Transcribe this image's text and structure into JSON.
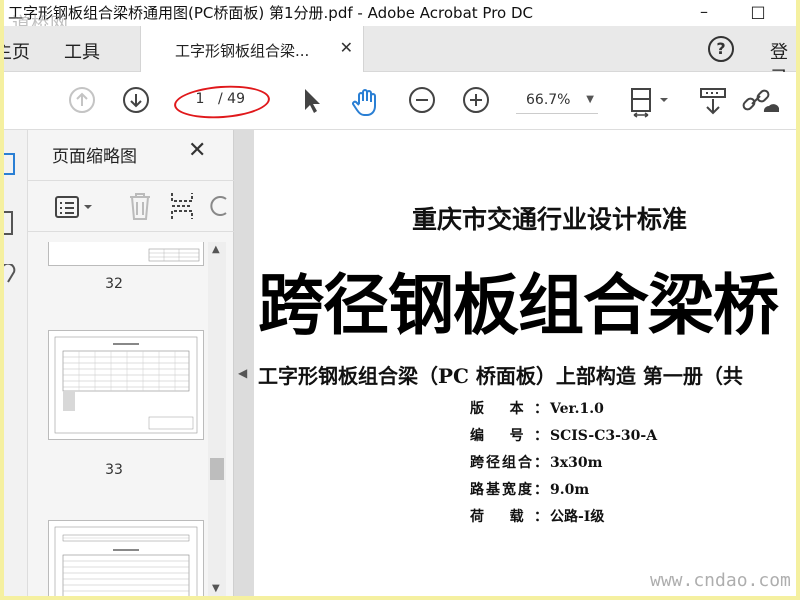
{
  "window": {
    "title": "工字形钢板组合梁桥通用图(PC桥面板) 第1分册.pdf - Adobe Acrobat Pro DC",
    "minimize": "–",
    "maximize": "□"
  },
  "watermarks": {
    "top_left": "道桥网",
    "bottom_right": "www.cndao.com"
  },
  "tabs": {
    "home": "主页",
    "tools": "工具",
    "document_tab": "工字形钢板组合梁...",
    "close": "✕",
    "help": "?",
    "login": "登录"
  },
  "toolbar": {
    "current_page": "1",
    "total_pages": "/ 49",
    "zoom": "66.7%"
  },
  "thumbnail_panel": {
    "title": "页面缩略图",
    "close": "✕",
    "page_labels": [
      "32",
      "33"
    ]
  },
  "document": {
    "heading": "重庆市交通行业设计标准",
    "big_title": "跨径钢板组合梁桥",
    "subtitle": "工字形钢板组合梁（PC 桥面板）上部构造  第一册（共",
    "meta": [
      {
        "key": "版 本：",
        "value": "Ver.1.0"
      },
      {
        "key": "编 号：",
        "value": "SCIS-C3-30-A"
      },
      {
        "key": "跨径组合：",
        "value": "3x30m"
      },
      {
        "key": "路基宽度：",
        "value": "9.0m"
      },
      {
        "key": "荷 载：",
        "value": "公路-I级"
      }
    ]
  },
  "colors": {
    "annotation_ellipse": "#e0181b",
    "hand_tool": "#2a7fd4",
    "outer_border": "#f5f0a0"
  }
}
